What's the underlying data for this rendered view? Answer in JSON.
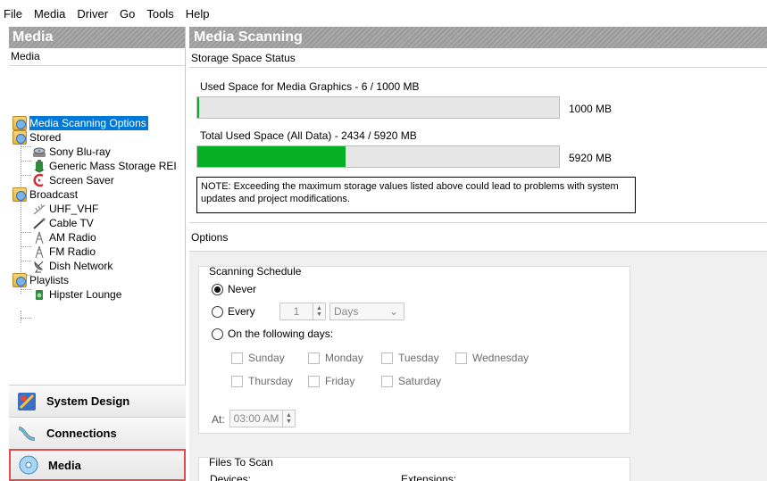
{
  "menu": [
    "File",
    "Media",
    "Driver",
    "Go",
    "Tools",
    "Help"
  ],
  "left": {
    "title": "Media",
    "subheader": "Media",
    "tree": {
      "media_scanning_options": "Media Scanning Options",
      "stored": "Stored",
      "sony": "Sony Blu-ray",
      "generic": "Generic Mass Storage REI",
      "screensaver": "Screen Saver",
      "broadcast": "Broadcast",
      "uhf": "UHF_VHF",
      "cable": "Cable TV",
      "am": "AM Radio",
      "fm": "FM Radio",
      "dish": "Dish Network",
      "playlists": "Playlists",
      "hipster": "Hipster Lounge"
    },
    "nav": {
      "system_design": "System Design",
      "connections": "Connections",
      "media": "Media"
    }
  },
  "right": {
    "title": "Media Scanning",
    "storage_title": "Storage Space Status",
    "used_graphics_label": "Used Space for Media Graphics - 6 / 1000 MB",
    "graphics_max": "1000 MB",
    "graphics_fraction": 0.006,
    "total_used_label": "Total Used Space (All Data) - 2434 / 5920 MB",
    "total_max": "5920 MB",
    "total_fraction": 0.411,
    "note": "NOTE: Exceeding the maximum storage values listed above could lead to problems with system updates and project modifications.",
    "options_title": "Options",
    "schedule": {
      "title": "Scanning Schedule",
      "never": "Never",
      "every": "Every",
      "every_value": "1",
      "unit": "Days",
      "following": "On the following days:",
      "days": {
        "sunday": "Sunday",
        "monday": "Monday",
        "tuesday": "Tuesday",
        "wednesday": "Wednesday",
        "thursday": "Thursday",
        "friday": "Friday",
        "saturday": "Saturday"
      },
      "at_label": "At:",
      "at_time": "03:00 AM"
    },
    "files": {
      "title": "Files To Scan",
      "devices": "Devices:",
      "extensions": "Extensions:"
    }
  },
  "colors": {
    "selection": "#0078d7",
    "progress": "#06b025",
    "highlight_border": "#e24b4b"
  }
}
